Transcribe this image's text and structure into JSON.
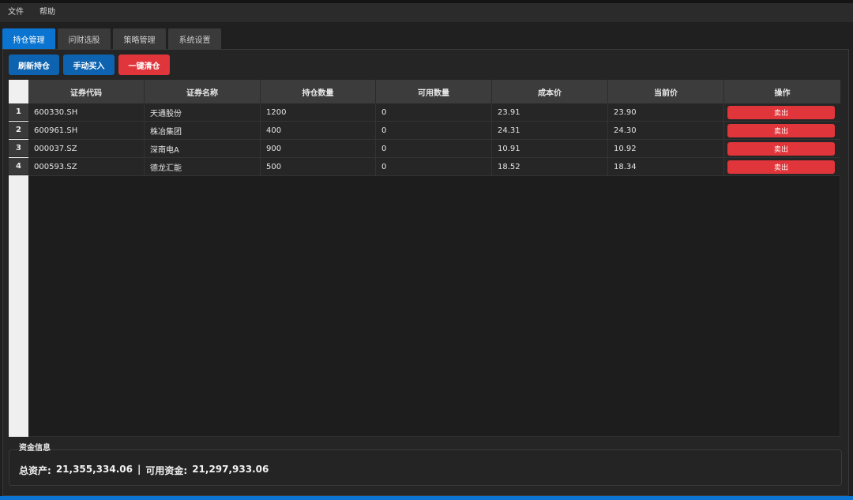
{
  "menu": {
    "items": [
      "文件",
      "帮助"
    ]
  },
  "tabs": [
    {
      "label": "持仓管理",
      "active": true
    },
    {
      "label": "问财选股",
      "active": false
    },
    {
      "label": "策略管理",
      "active": false
    },
    {
      "label": "系统设置",
      "active": false
    }
  ],
  "toolbar": {
    "refresh_label": "刷新持仓",
    "buy_label": "手动买入",
    "clear_label": "一键清仓"
  },
  "table": {
    "columns": [
      "证券代码",
      "证券名称",
      "持仓数量",
      "可用数量",
      "成本价",
      "当前价",
      "操作"
    ],
    "rows": [
      {
        "num": "1",
        "code": "600330.SH",
        "name": "天通股份",
        "qty": "1200",
        "avail": "0",
        "cost": "23.91",
        "price": "23.90",
        "action": "卖出"
      },
      {
        "num": "2",
        "code": "600961.SH",
        "name": "株冶集团",
        "qty": "400",
        "avail": "0",
        "cost": "24.31",
        "price": "24.30",
        "action": "卖出"
      },
      {
        "num": "3",
        "code": "000037.SZ",
        "name": "深南电A",
        "qty": "900",
        "avail": "0",
        "cost": "10.91",
        "price": "10.92",
        "action": "卖出"
      },
      {
        "num": "4",
        "code": "000593.SZ",
        "name": "德龙汇能",
        "qty": "500",
        "avail": "0",
        "cost": "18.52",
        "price": "18.34",
        "action": "卖出"
      }
    ]
  },
  "fund": {
    "title": "资金信息",
    "total_label": "总资产:",
    "total_value": "21,355,334.06",
    "separator": "|",
    "available_label": "可用资金:",
    "available_value": "21,297,933.06"
  },
  "colors": {
    "accent": "#0a74d0",
    "danger": "#e0353a",
    "button_blue": "#0d63b0",
    "background": "#202020"
  }
}
